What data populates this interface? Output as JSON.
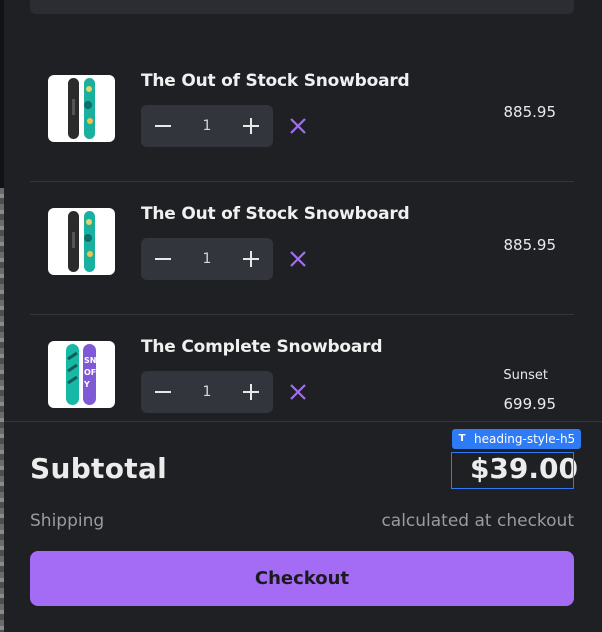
{
  "items": [
    {
      "title": "The Out of Stock Snowboard",
      "quantity": "1",
      "variant": "",
      "price": "885.95",
      "image": "snowboard-out-of-stock-thumbnail"
    },
    {
      "title": "The Out of Stock Snowboard",
      "quantity": "1",
      "variant": "",
      "price": "885.95",
      "image": "snowboard-out-of-stock-thumbnail"
    },
    {
      "title": "The Complete Snowboard",
      "quantity": "1",
      "variant": "Sunset",
      "price": "699.95",
      "image": "snowboard-complete-thumbnail"
    }
  ],
  "footer": {
    "subtotal_label": "Subtotal",
    "subtotal_value": "$39.00",
    "shipping_label": "Shipping",
    "shipping_value": "calculated at checkout",
    "checkout_label": "Checkout"
  },
  "inspector_tag": {
    "icon": "T",
    "label": "heading-style-h5"
  },
  "icons": {
    "decrease": "minus-icon",
    "increase": "plus-icon",
    "remove": "close-icon"
  },
  "colors": {
    "accent": "#a46cf5",
    "highlight": "#2f7bf6",
    "background": "#1f2024"
  }
}
